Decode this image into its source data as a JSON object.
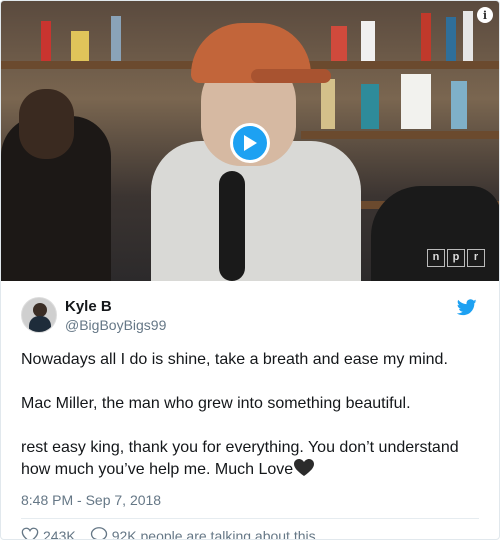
{
  "video": {
    "watermark_letters": [
      "n",
      "p",
      "r"
    ],
    "icons": {
      "play": "play-icon",
      "info": "info-icon"
    }
  },
  "tweet": {
    "author_name": "Kyle B",
    "author_handle": "@BigBoyBigs99",
    "lines": {
      "line1": "Nowadays all I do is shine, take a breath and ease my mind.",
      "line2": "Mac Miller, the man who grew into something beautiful.",
      "line3a": "rest easy king, thank you for everything. You don’t understand",
      "line3b": "how much you’ve help me. Much Love"
    },
    "timestamp": "8:48 PM - Sep 7, 2018",
    "likes_count": "243K",
    "conversation_text": "92K people are talking about this"
  },
  "colors": {
    "twitter_blue": "#1da1f2",
    "text_primary": "#14171a",
    "text_secondary": "#657786"
  }
}
